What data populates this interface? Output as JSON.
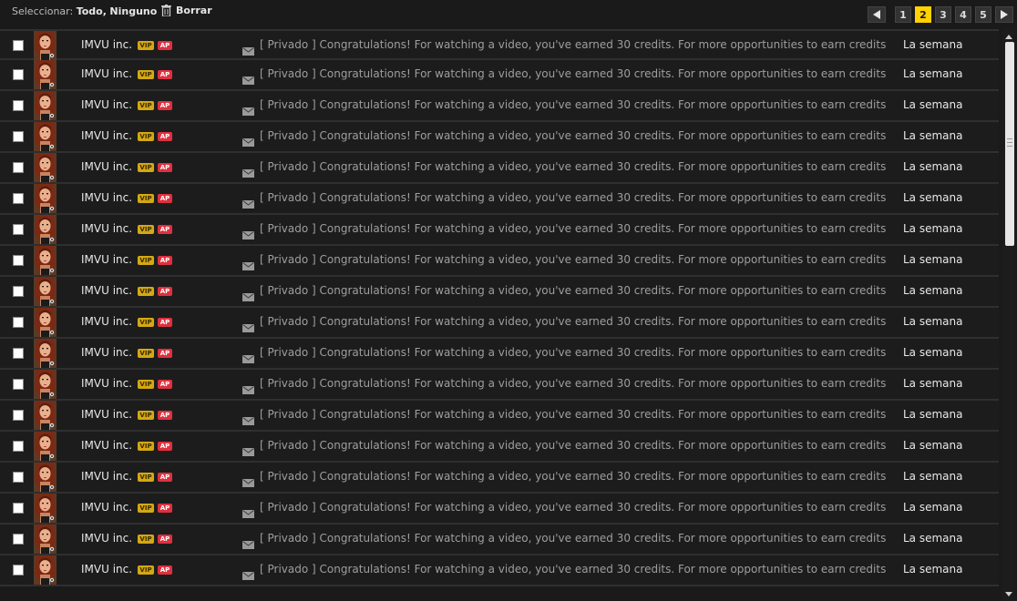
{
  "toolbar": {
    "select_label": "Seleccionar:",
    "select_all": "Todo",
    "separator": ",",
    "select_none": "Ninguno",
    "delete_label": "Borrar"
  },
  "pager": {
    "pages": [
      "1",
      "2",
      "3",
      "4",
      "5"
    ],
    "active_page": "2",
    "accent_color": "#ffd200"
  },
  "messages": [
    {
      "sender": "IMVU inc.",
      "badge_vip": "VIP",
      "badge_ap": "AP",
      "subject": "[ Privado ] Congratulations! For watching a video, you've earned 30 credits. For more opportunities to earn credits",
      "date": "La semana"
    },
    {
      "sender": "IMVU inc.",
      "badge_vip": "VIP",
      "badge_ap": "AP",
      "subject": "[ Privado ] Congratulations! For watching a video, you've earned 30 credits. For more opportunities to earn credits",
      "date": "La semana"
    },
    {
      "sender": "IMVU inc.",
      "badge_vip": "VIP",
      "badge_ap": "AP",
      "subject": "[ Privado ] Congratulations! For watching a video, you've earned 30 credits. For more opportunities to earn credits",
      "date": "La semana"
    },
    {
      "sender": "IMVU inc.",
      "badge_vip": "VIP",
      "badge_ap": "AP",
      "subject": "[ Privado ] Congratulations! For watching a video, you've earned 30 credits. For more opportunities to earn credits",
      "date": "La semana"
    },
    {
      "sender": "IMVU inc.",
      "badge_vip": "VIP",
      "badge_ap": "AP",
      "subject": "[ Privado ] Congratulations! For watching a video, you've earned 30 credits. For more opportunities to earn credits",
      "date": "La semana"
    },
    {
      "sender": "IMVU inc.",
      "badge_vip": "VIP",
      "badge_ap": "AP",
      "subject": "[ Privado ] Congratulations! For watching a video, you've earned 30 credits. For more opportunities to earn credits",
      "date": "La semana"
    },
    {
      "sender": "IMVU inc.",
      "badge_vip": "VIP",
      "badge_ap": "AP",
      "subject": "[ Privado ] Congratulations! For watching a video, you've earned 30 credits. For more opportunities to earn credits",
      "date": "La semana"
    },
    {
      "sender": "IMVU inc.",
      "badge_vip": "VIP",
      "badge_ap": "AP",
      "subject": "[ Privado ] Congratulations! For watching a video, you've earned 30 credits. For more opportunities to earn credits",
      "date": "La semana"
    },
    {
      "sender": "IMVU inc.",
      "badge_vip": "VIP",
      "badge_ap": "AP",
      "subject": "[ Privado ] Congratulations! For watching a video, you've earned 30 credits. For more opportunities to earn credits",
      "date": "La semana"
    },
    {
      "sender": "IMVU inc.",
      "badge_vip": "VIP",
      "badge_ap": "AP",
      "subject": "[ Privado ] Congratulations! For watching a video, you've earned 30 credits. For more opportunities to earn credits",
      "date": "La semana"
    },
    {
      "sender": "IMVU inc.",
      "badge_vip": "VIP",
      "badge_ap": "AP",
      "subject": "[ Privado ] Congratulations! For watching a video, you've earned 30 credits. For more opportunities to earn credits",
      "date": "La semana"
    },
    {
      "sender": "IMVU inc.",
      "badge_vip": "VIP",
      "badge_ap": "AP",
      "subject": "[ Privado ] Congratulations! For watching a video, you've earned 30 credits. For more opportunities to earn credits",
      "date": "La semana"
    },
    {
      "sender": "IMVU inc.",
      "badge_vip": "VIP",
      "badge_ap": "AP",
      "subject": "[ Privado ] Congratulations! For watching a video, you've earned 30 credits. For more opportunities to earn credits",
      "date": "La semana"
    },
    {
      "sender": "IMVU inc.",
      "badge_vip": "VIP",
      "badge_ap": "AP",
      "subject": "[ Privado ] Congratulations! For watching a video, you've earned 30 credits. For more opportunities to earn credits",
      "date": "La semana"
    },
    {
      "sender": "IMVU inc.",
      "badge_vip": "VIP",
      "badge_ap": "AP",
      "subject": "[ Privado ] Congratulations! For watching a video, you've earned 30 credits. For more opportunities to earn credits",
      "date": "La semana"
    },
    {
      "sender": "IMVU inc.",
      "badge_vip": "VIP",
      "badge_ap": "AP",
      "subject": "[ Privado ] Congratulations! For watching a video, you've earned 30 credits. For more opportunities to earn credits",
      "date": "La semana"
    },
    {
      "sender": "IMVU inc.",
      "badge_vip": "VIP",
      "badge_ap": "AP",
      "subject": "[ Privado ] Congratulations! For watching a video, you've earned 30 credits. For more opportunities to earn credits",
      "date": "La semana"
    },
    {
      "sender": "IMVU inc.",
      "badge_vip": "VIP",
      "badge_ap": "AP",
      "subject": "[ Privado ] Congratulations! For watching a video, you've earned 30 credits. For more opportunities to earn credits",
      "date": "La semana"
    }
  ],
  "icons": {
    "delete": "trash-icon",
    "message": "envelope-icon",
    "prev": "arrow-left-icon",
    "next": "arrow-right-icon"
  },
  "colors": {
    "vip_badge": "#d4a814",
    "ap_badge": "#e0303f",
    "background": "#1a1a1a"
  }
}
